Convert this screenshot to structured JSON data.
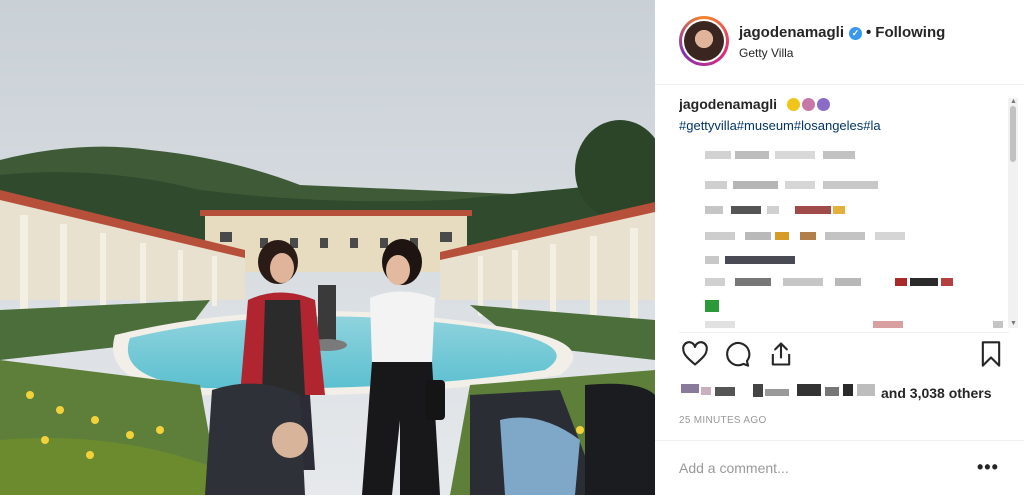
{
  "post": {
    "username": "jagodenamagli",
    "verified_icon": "verified-badge-icon",
    "separator": "•",
    "follow_status": "Following",
    "location": "Getty Villa",
    "caption_user": "jagodenamagli",
    "caption_emojis": [
      "woman-emoji",
      "women-emoji",
      "women-emoji"
    ],
    "hashtags": "#gettyvilla#museum#losangeles#la",
    "likes_suffix": "and 3,038 others",
    "timestamp": "25 MINUTES AGO",
    "comment_placeholder": "Add a comment...",
    "more_options": "•••"
  },
  "icons": {
    "like": "heart-icon",
    "comment": "comment-icon",
    "share": "share-icon",
    "save": "bookmark-icon"
  },
  "colors": {
    "link": "#003569",
    "verified": "#3897f0",
    "text": "#262626",
    "muted": "#999999"
  }
}
